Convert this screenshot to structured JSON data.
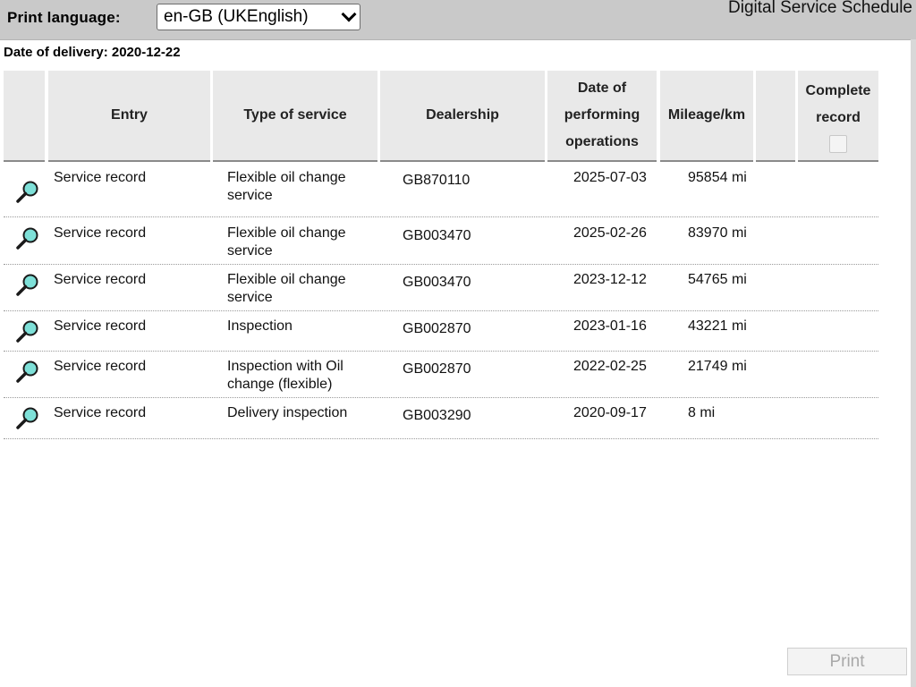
{
  "header": {
    "print_language_label": "Print language:",
    "language_selected": "en-GB (UKEnglish)",
    "app_title": "Digital Service Schedule"
  },
  "delivery": {
    "text": "Date of delivery: 2020-12-22"
  },
  "table": {
    "columns": [
      "",
      "Entry",
      "Type of service",
      "Dealership",
      "Date of\nperforming\noperations",
      "Mileage/km",
      "",
      "Complete\nrecord"
    ],
    "rows": [
      {
        "entry": "Service record",
        "type_of_service": "Flexible oil change\nservice",
        "dealership": "GB870110",
        "date": "2025-07-03",
        "mileage": "95854 mi"
      },
      {
        "entry": "Service record",
        "type_of_service": "Flexible oil change\nservice",
        "dealership": "GB003470",
        "date": "2025-02-26",
        "mileage": "83970 mi"
      },
      {
        "entry": "Service record",
        "type_of_service": "Flexible oil change\nservice",
        "dealership": "GB003470",
        "date": "2023-12-12",
        "mileage": "54765 mi"
      },
      {
        "entry": "Service record",
        "type_of_service": "Inspection",
        "dealership": "GB002870",
        "date": "2023-01-16",
        "mileage": "43221 mi"
      },
      {
        "entry": "Service record",
        "type_of_service": "Inspection with Oil\nchange (flexible)",
        "dealership": "GB002870",
        "date": "2022-02-25",
        "mileage": "21749 mi"
      },
      {
        "entry": "Service record",
        "type_of_service": "Delivery inspection",
        "dealership": "GB003290",
        "date": "2020-09-17",
        "mileage": "8 mi"
      }
    ],
    "complete_record_checked": false
  },
  "footer": {
    "print_label": "Print"
  },
  "icons": {
    "row_icon": "magnifier-icon",
    "select_icon": "chevron-down-icon"
  },
  "colors": {
    "header_bar": "#c9c9c9",
    "table_header": "#e9e9e9",
    "magnifier_lens": "#7ee0d8"
  }
}
